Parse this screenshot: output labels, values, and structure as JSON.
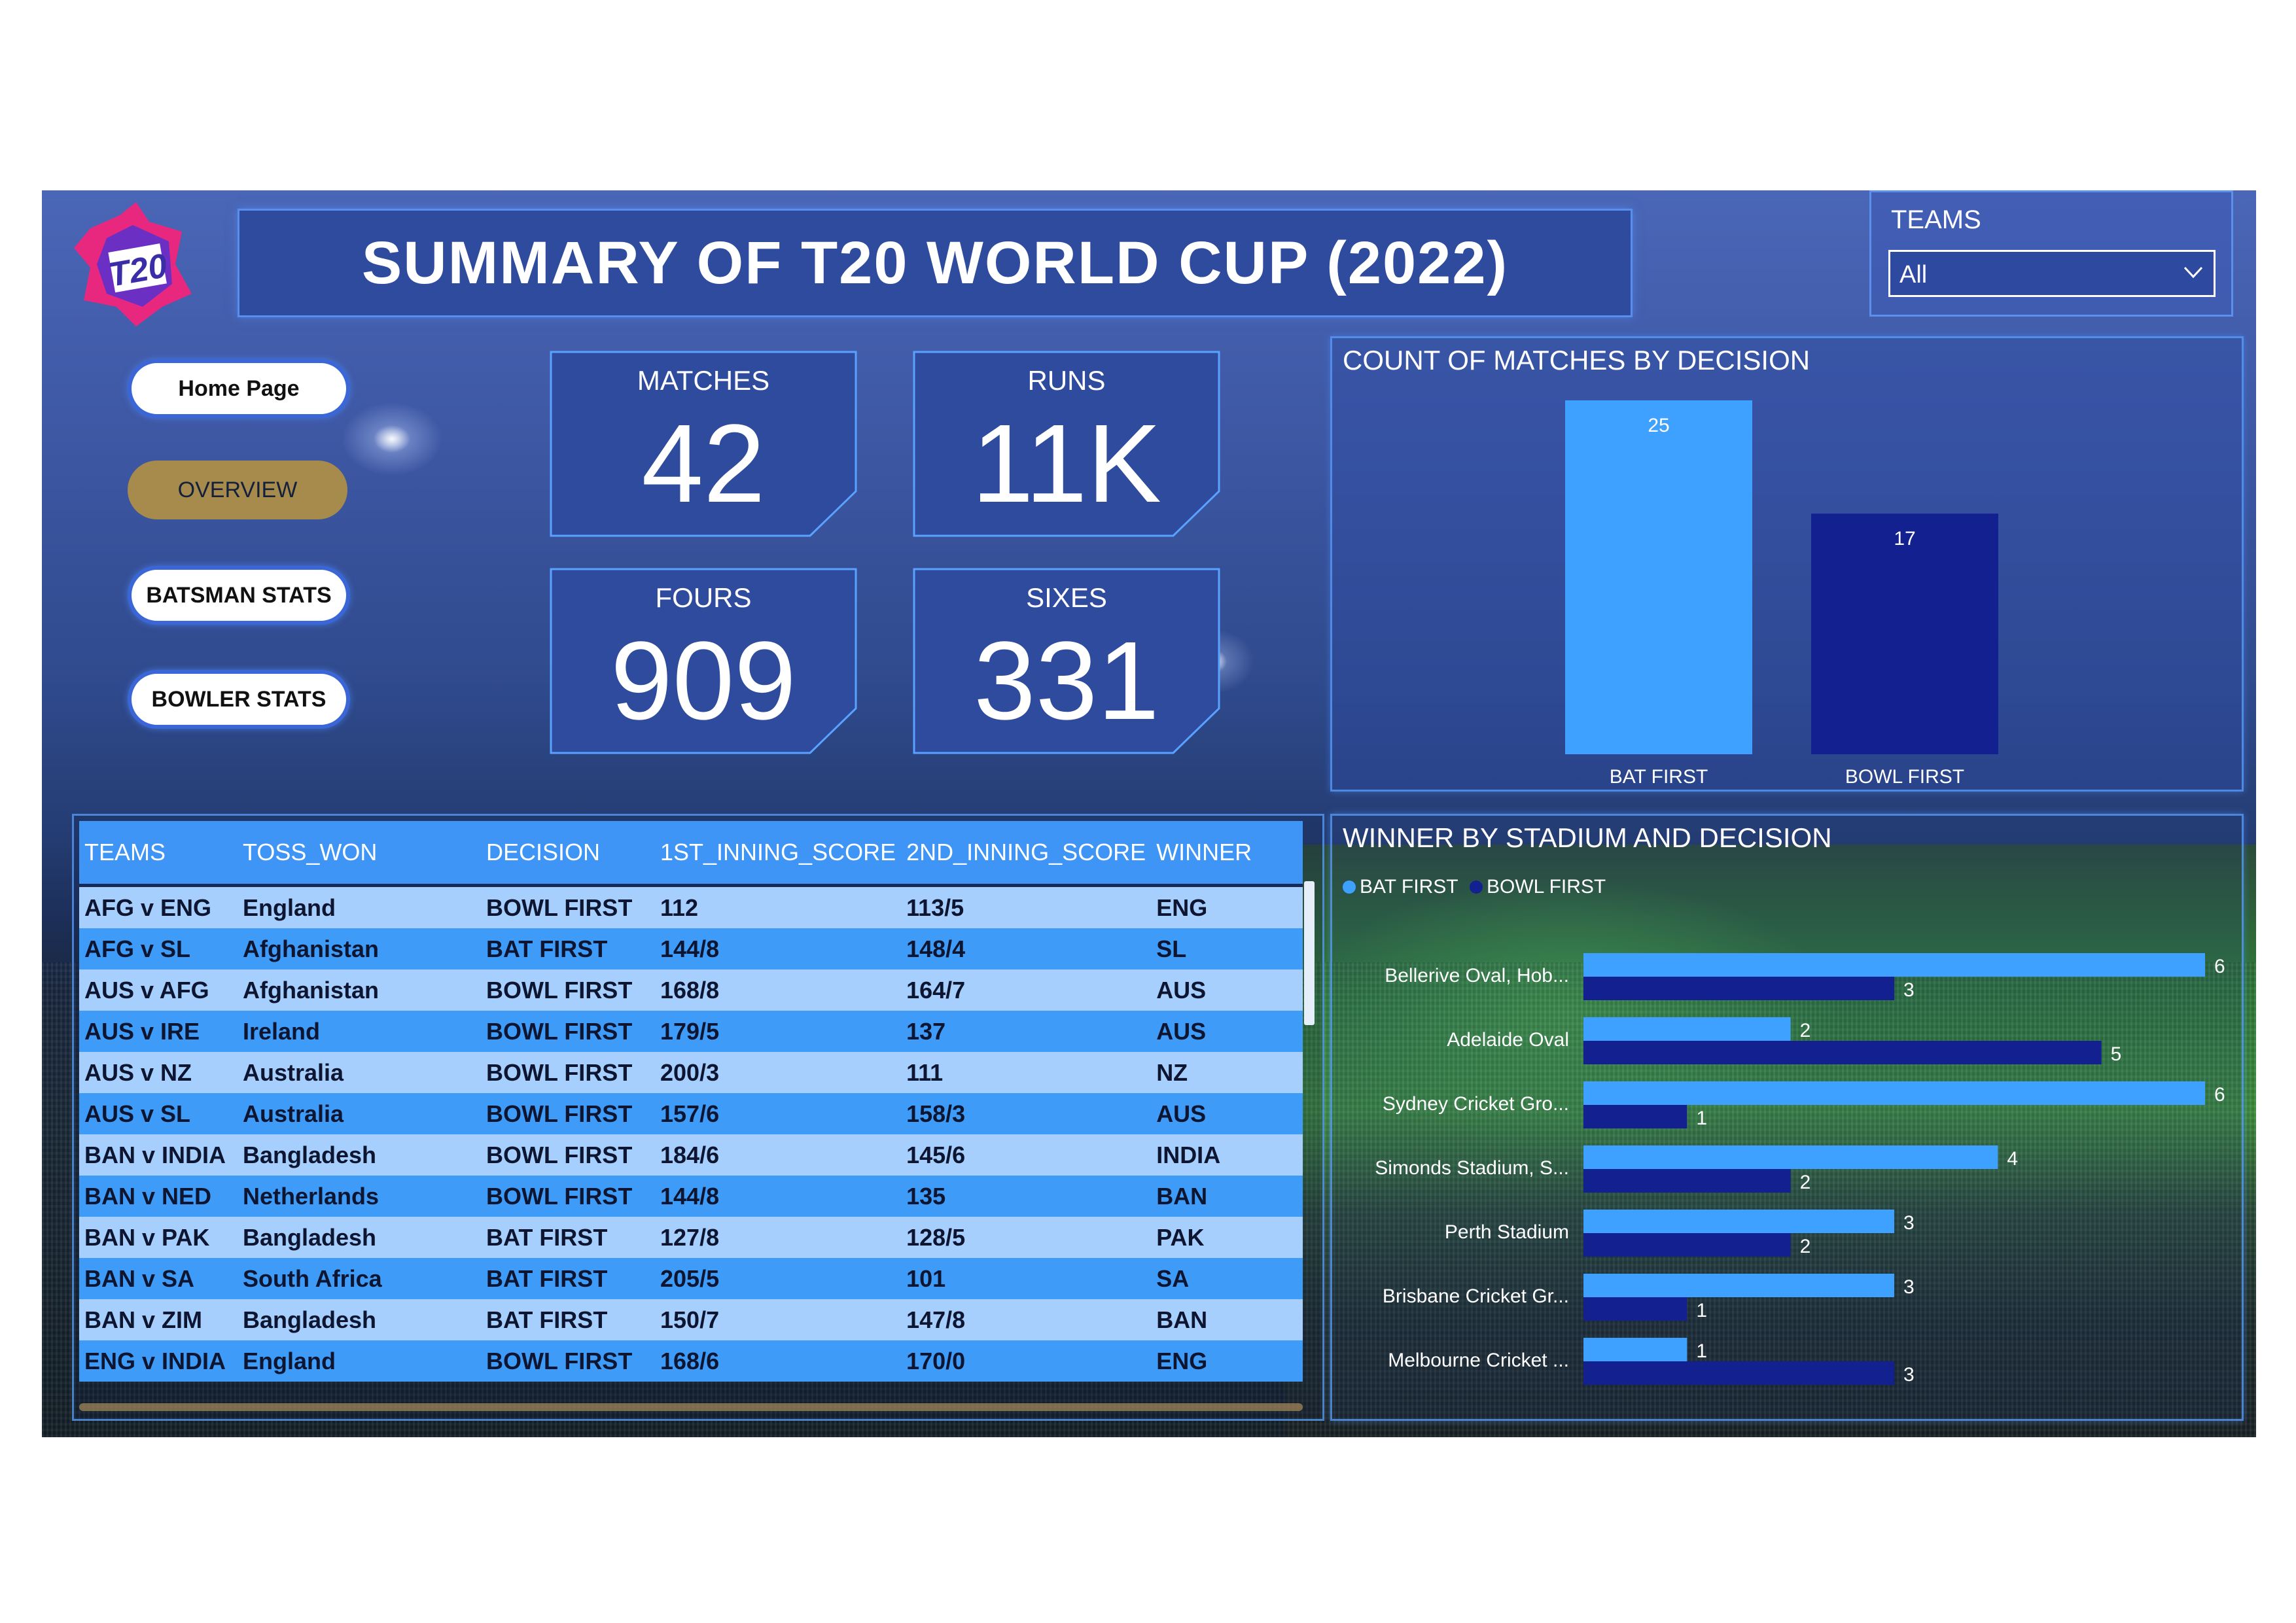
{
  "header": {
    "logo_text": "T20",
    "title": "SUMMARY OF T20 WORLD CUP (2022)"
  },
  "slicer": {
    "label": "TEAMS",
    "value": "All",
    "icon": "chevron-down-icon"
  },
  "nav": [
    {
      "label": "Home Page",
      "style": "white"
    },
    {
      "label": "OVERVIEW",
      "style": "gold"
    },
    {
      "label": "BATSMAN STATS",
      "style": "white"
    },
    {
      "label": "BOWLER STATS",
      "style": "white"
    }
  ],
  "kpis": [
    {
      "label": "MATCHES",
      "value": "42"
    },
    {
      "label": "RUNS",
      "value": "11K"
    },
    {
      "label": "FOURS",
      "value": "909"
    },
    {
      "label": "SIXES",
      "value": "331"
    }
  ],
  "colors": {
    "bat_first": "#3ea1ff",
    "bowl_first": "#13208f",
    "kpi_card": "#2f4b9e",
    "row_light": "#a6cffd",
    "row_dark": "#3e9bf7",
    "header_row": "#3e95f6",
    "nav_gold": "#a68b4d"
  },
  "table": {
    "columns": [
      "TEAMS",
      "TOSS_WON",
      "DECISION",
      "1ST_INNING_SCORE",
      "2ND_INNING_SCORE",
      "WINNER"
    ],
    "rows": [
      [
        "AFG v ENG",
        "England",
        "BOWL FIRST",
        "112",
        "113/5",
        "ENG"
      ],
      [
        "AFG v SL",
        "Afghanistan",
        "BAT FIRST",
        "144/8",
        "148/4",
        "SL"
      ],
      [
        "AUS v AFG",
        "Afghanistan",
        "BOWL FIRST",
        "168/8",
        "164/7",
        "AUS"
      ],
      [
        "AUS v IRE",
        "Ireland",
        "BOWL FIRST",
        "179/5",
        "137",
        "AUS"
      ],
      [
        "AUS v NZ",
        "Australia",
        "BOWL FIRST",
        "200/3",
        "111",
        "NZ"
      ],
      [
        "AUS v SL",
        "Australia",
        "BOWL FIRST",
        "157/6",
        "158/3",
        "AUS"
      ],
      [
        "BAN v INDIA",
        "Bangladesh",
        "BOWL FIRST",
        "184/6",
        "145/6",
        "INDIA"
      ],
      [
        "BAN v NED",
        "Netherlands",
        "BOWL FIRST",
        "144/8",
        "135",
        "BAN"
      ],
      [
        "BAN v PAK",
        "Bangladesh",
        "BAT FIRST",
        "127/8",
        "128/5",
        "PAK"
      ],
      [
        "BAN v SA",
        "South Africa",
        "BAT FIRST",
        "205/5",
        "101",
        "SA"
      ],
      [
        "BAN v ZIM",
        "Bangladesh",
        "BAT FIRST",
        "150/7",
        "147/8",
        "BAN"
      ],
      [
        "ENG v INDIA",
        "England",
        "BOWL FIRST",
        "168/6",
        "170/0",
        "ENG"
      ]
    ]
  },
  "chart_data": [
    {
      "type": "bar",
      "title": "COUNT OF MATCHES BY DECISION",
      "categories": [
        "BAT FIRST",
        "BOWL FIRST"
      ],
      "values": [
        25,
        17
      ],
      "data_labels": [
        "25",
        "17"
      ],
      "colors": [
        "#3ea1ff",
        "#13208f"
      ],
      "legend": false,
      "grid": false
    },
    {
      "type": "bar",
      "orientation": "horizontal",
      "title": "WINNER BY STADIUM AND DECISION",
      "legend_position": "top-left",
      "categories": [
        "Bellerive Oval, Hob...",
        "Adelaide Oval",
        "Sydney Cricket Gro...",
        "Simonds Stadium, S...",
        "Perth Stadium",
        "Brisbane Cricket Gr...",
        "Melbourne Cricket ..."
      ],
      "series": [
        {
          "name": "BAT FIRST",
          "color": "#3ea1ff",
          "values": [
            6,
            2,
            6,
            4,
            3,
            3,
            1
          ]
        },
        {
          "name": "BOWL FIRST",
          "color": "#13208f",
          "values": [
            3,
            5,
            1,
            2,
            2,
            1,
            3
          ]
        }
      ],
      "grid": false
    }
  ]
}
